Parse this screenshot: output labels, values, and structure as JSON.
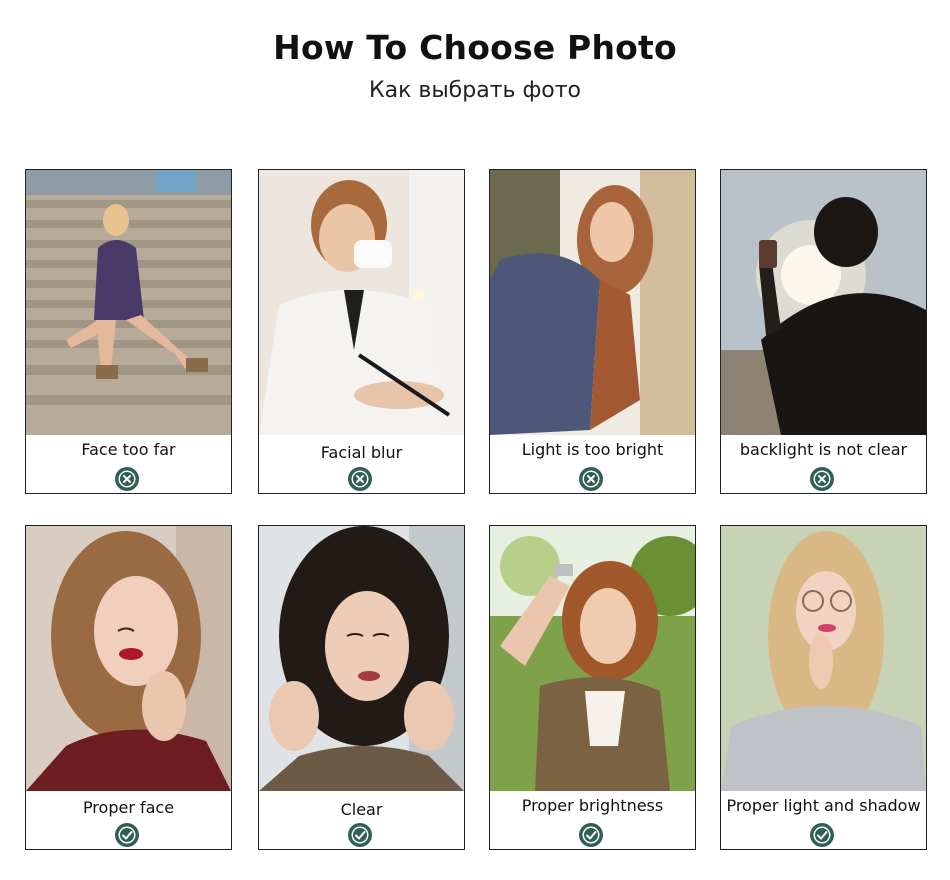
{
  "header": {
    "title": "How To Choose Photo",
    "subtitle": "Как выбрать фото"
  },
  "colors": {
    "badge": "#2f5f55",
    "border": "#222222"
  },
  "bad_examples": [
    {
      "caption": "Face too far",
      "status_icon": "cross-icon"
    },
    {
      "caption": "Facial blur",
      "status_icon": "cross-icon"
    },
    {
      "caption": "Light is too bright",
      "status_icon": "cross-icon"
    },
    {
      "caption": "backlight is not clear",
      "status_icon": "cross-icon"
    }
  ],
  "good_examples": [
    {
      "caption": "Proper face",
      "status_icon": "check-icon"
    },
    {
      "caption": "Clear",
      "status_icon": "check-icon"
    },
    {
      "caption": "Proper brightness",
      "status_icon": "check-icon"
    },
    {
      "caption": "Proper light and shadow",
      "status_icon": "check-icon"
    }
  ]
}
